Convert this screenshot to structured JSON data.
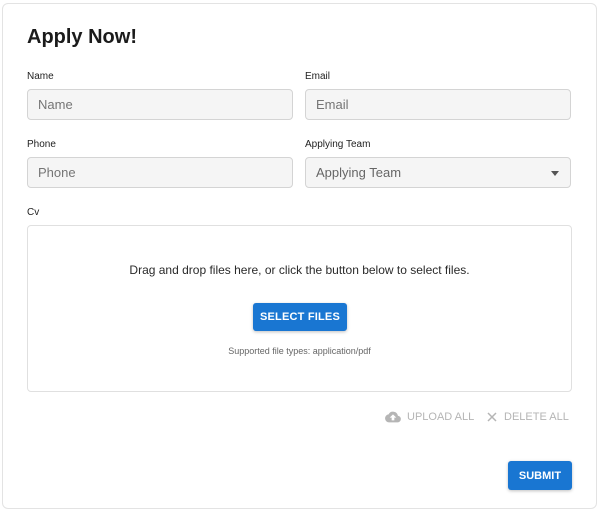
{
  "form": {
    "title": "Apply Now!",
    "name": {
      "label": "Name",
      "placeholder": "Name"
    },
    "email": {
      "label": "Email",
      "placeholder": "Email"
    },
    "phone": {
      "label": "Phone",
      "placeholder": "Phone"
    },
    "team": {
      "label": "Applying Team",
      "placeholder": "Applying Team"
    },
    "cv": {
      "label": "Cv",
      "instructions": "Drag and drop files here, or click the button below to select files.",
      "select_label": "SELECT FILES",
      "supported_types": "Supported file types: application/pdf"
    },
    "actions": {
      "upload_all": "UPLOAD ALL",
      "delete_all": "DELETE ALL",
      "submit": "SUBMIT"
    }
  },
  "icons": {
    "upload": "cloud-upload-icon",
    "delete": "close-icon",
    "dropdown": "caret-down-icon"
  },
  "colors": {
    "primary": "#1976d2",
    "disabled_text": "#b5b5b5",
    "field_bg": "#f5f5f5"
  }
}
